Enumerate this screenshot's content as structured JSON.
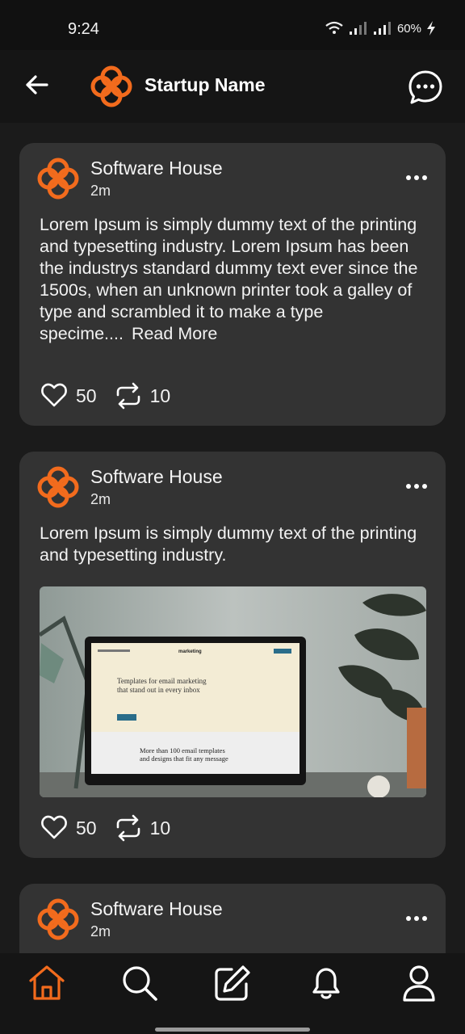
{
  "status_bar": {
    "time": "9:24",
    "battery": "60%"
  },
  "header": {
    "title": "Startup Name",
    "back_icon": "arrow-left-icon",
    "chat_icon": "chat-bubble-icon"
  },
  "colors": {
    "accent": "#f26b1d",
    "card": "#333333",
    "background": "#1b1b1b"
  },
  "posts": [
    {
      "author": "Software House",
      "time": "2m",
      "text": "Lorem Ipsum is simply dummy text of the printing and typesetting industry. Lorem Ipsum has been the industrys standard dummy text ever since the 1500s, when an unknown printer took a galley of type and scrambled it to make a type specime....",
      "read_more": "Read More",
      "likes": "50",
      "reposts": "10"
    },
    {
      "author": "Software House",
      "time": "2m",
      "text": "Lorem Ipsum is simply dummy text of the printing and typesetting industry.",
      "image": {
        "headline": "Templates for email marketing that stand out in every inbox",
        "footer_line1": "More than 100 email templates",
        "footer_line2": "and designs that fit any message",
        "brand": "marketing"
      },
      "likes": "50",
      "reposts": "10"
    },
    {
      "author": "Software House",
      "time": "2m"
    }
  ],
  "bottom_nav": [
    "home-icon",
    "search-icon",
    "edit-icon",
    "bell-icon",
    "profile-icon"
  ]
}
